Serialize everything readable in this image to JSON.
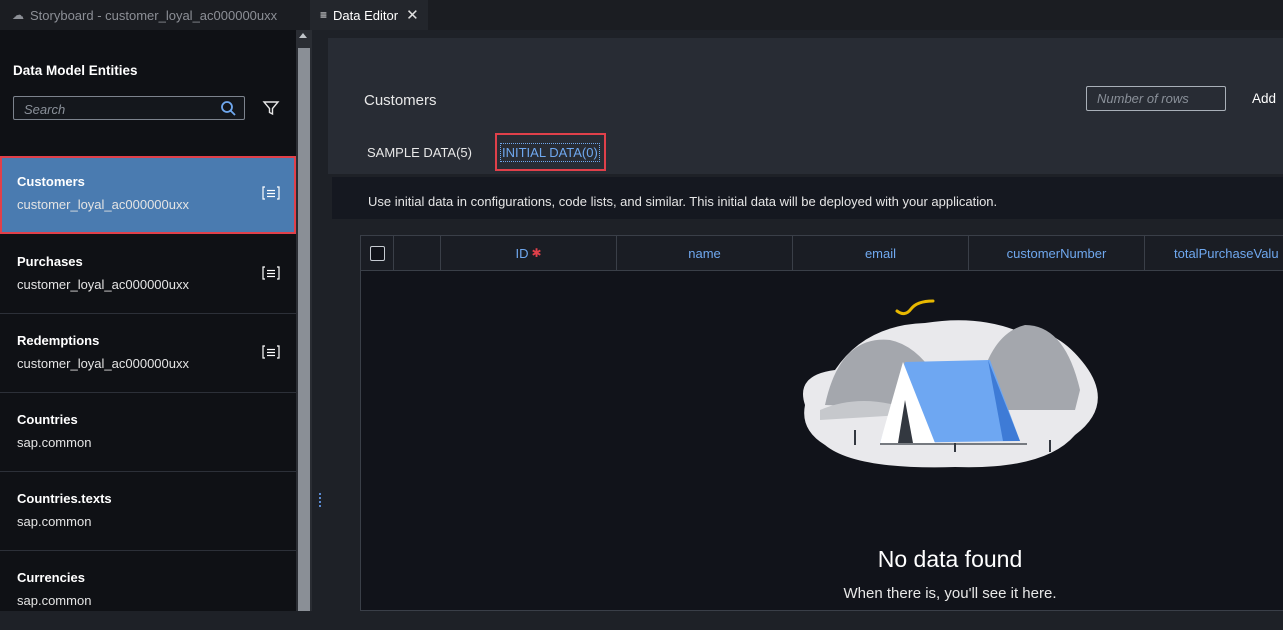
{
  "tabs": [
    {
      "label": "Storyboard - customer_loyal_ac000000uxx",
      "icon": "cloud-icon",
      "active": false
    },
    {
      "label": "Data Editor",
      "icon": "list-icon",
      "active": true
    }
  ],
  "sidebar": {
    "title": "Data Model Entities",
    "search_placeholder": "Search",
    "items": [
      {
        "name": "Customers",
        "namespace": "customer_loyal_ac000000uxx",
        "selected": true
      },
      {
        "name": "Purchases",
        "namespace": "customer_loyal_ac000000uxx"
      },
      {
        "name": "Redemptions",
        "namespace": "customer_loyal_ac000000uxx"
      },
      {
        "name": "Countries",
        "namespace": "sap.common"
      },
      {
        "name": "Countries.texts",
        "namespace": "sap.common"
      },
      {
        "name": "Currencies",
        "namespace": "sap.common"
      }
    ]
  },
  "main": {
    "entity_title": "Customers",
    "rows_placeholder": "Number of rows",
    "add_label": "Add",
    "subtabs": [
      "SAMPLE DATA(5)",
      "INITIAL DATA(0)"
    ],
    "info_text": "Use initial data in configurations, code lists, and similar. This initial data will be deployed with your application.",
    "columns": [
      "ID",
      "name",
      "email",
      "customerNumber",
      "totalPurchaseValu"
    ],
    "empty_title": "No data found",
    "empty_subtitle": "When there is, you'll see it here."
  },
  "colors": {
    "selected_bg": "#4a7bb0",
    "highlight_border": "#e0404a",
    "link_blue": "#6fa8ef"
  }
}
